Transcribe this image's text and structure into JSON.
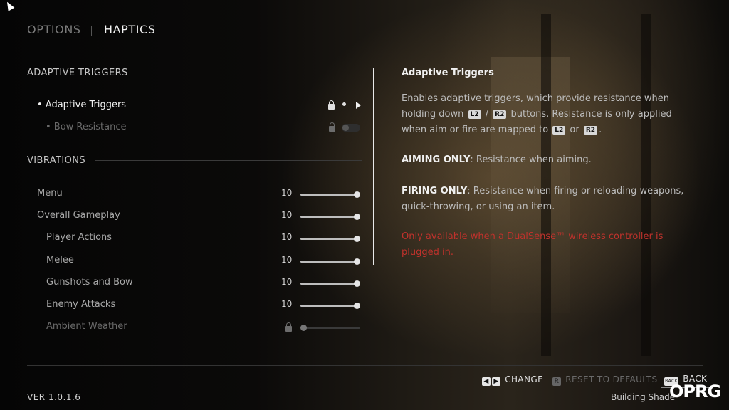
{
  "header": {
    "tab_options": "OPTIONS",
    "tab_haptics": "HAPTICS"
  },
  "sections": {
    "adaptive_triggers": "ADAPTIVE TRIGGERS",
    "vibrations": "VIBRATIONS"
  },
  "adaptive_items": [
    {
      "label": "• Adaptive Triggers"
    },
    {
      "label": "• Bow Resistance"
    }
  ],
  "vibration_items": [
    {
      "label": "Menu",
      "value": "10"
    },
    {
      "label": "Overall Gameplay",
      "value": "10"
    },
    {
      "label": "Player Actions",
      "value": "10"
    },
    {
      "label": "Melee",
      "value": "10"
    },
    {
      "label": "Gunshots and Bow",
      "value": "10"
    },
    {
      "label": "Enemy Attacks",
      "value": "10"
    },
    {
      "label": "Ambient Weather",
      "value": ""
    }
  ],
  "description": {
    "title": "Adaptive Triggers",
    "p1_a": "Enables adaptive triggers, which provide resistance when holding down ",
    "l2": "L2",
    "slash": " / ",
    "r2": "R2",
    "p1_b": " buttons. Resistance is only applied when aim or fire are mapped to ",
    "or": " or ",
    "period": ".",
    "aiming_title": "AIMING ONLY",
    "aiming_text": ": Resistance when aiming.",
    "firing_title": "FIRING ONLY",
    "firing_text": ": Resistance when firing or reloading weapons, quick-throwing, or using an item.",
    "warning": "Only available when a DualSense™ wireless controller is plugged in."
  },
  "footer": {
    "change": "CHANGE",
    "reset": "RESET TO DEFAULTS",
    "back": "BACK",
    "back_key": "BACK",
    "reset_key": "R",
    "version": "VER 1.0.1.6",
    "building": "Building Shade",
    "watermark": "OPRG"
  },
  "colors": {
    "warning": "#c0322c",
    "accent_text": "#f2f2f2"
  }
}
